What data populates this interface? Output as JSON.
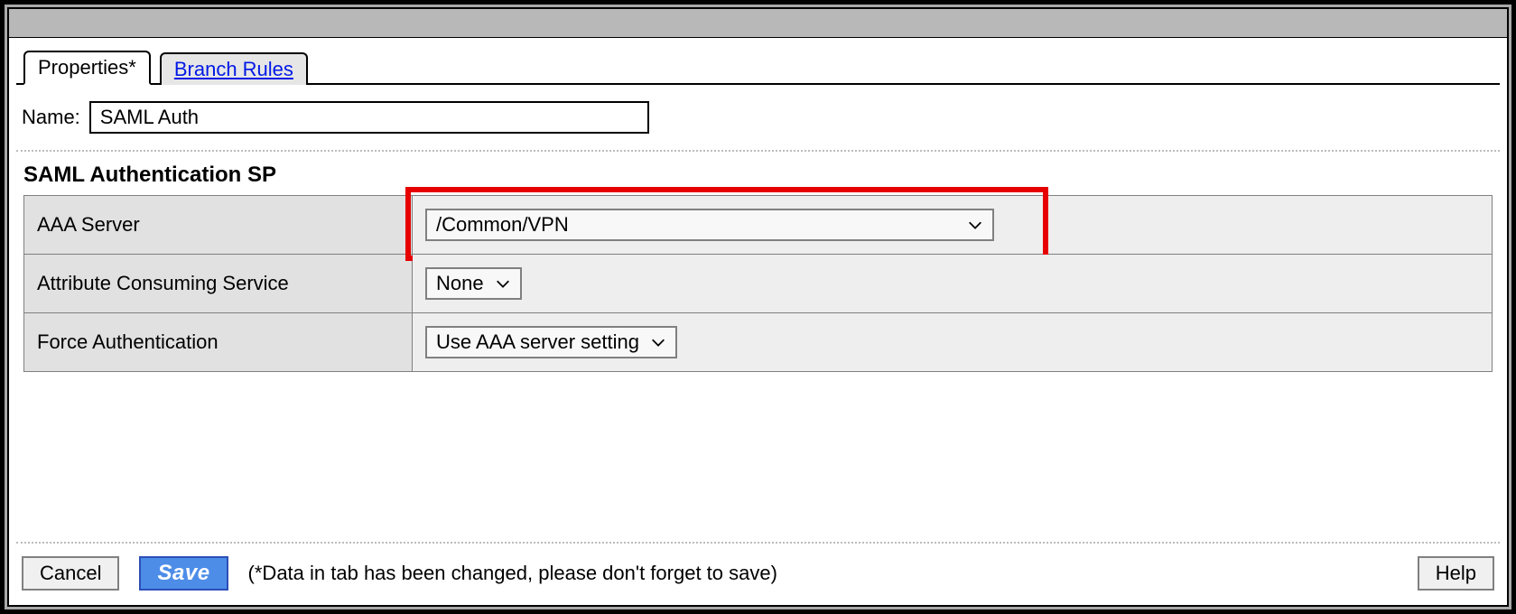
{
  "tabs": {
    "properties_label": "Properties*",
    "branch_rules_label": "Branch Rules"
  },
  "name_field": {
    "label": "Name:",
    "value": "SAML Auth"
  },
  "section": {
    "title": "SAML Authentication SP"
  },
  "rows": {
    "aaa_server": {
      "label": "AAA Server",
      "value": "/Common/VPN"
    },
    "attribute_consuming_service": {
      "label": "Attribute Consuming Service",
      "value": "None"
    },
    "force_authentication": {
      "label": "Force Authentication",
      "value": "Use AAA server setting"
    }
  },
  "buttons": {
    "cancel": "Cancel",
    "save": "Save",
    "help": "Help"
  },
  "note": "(*Data in tab has been changed, please don't forget to save)"
}
